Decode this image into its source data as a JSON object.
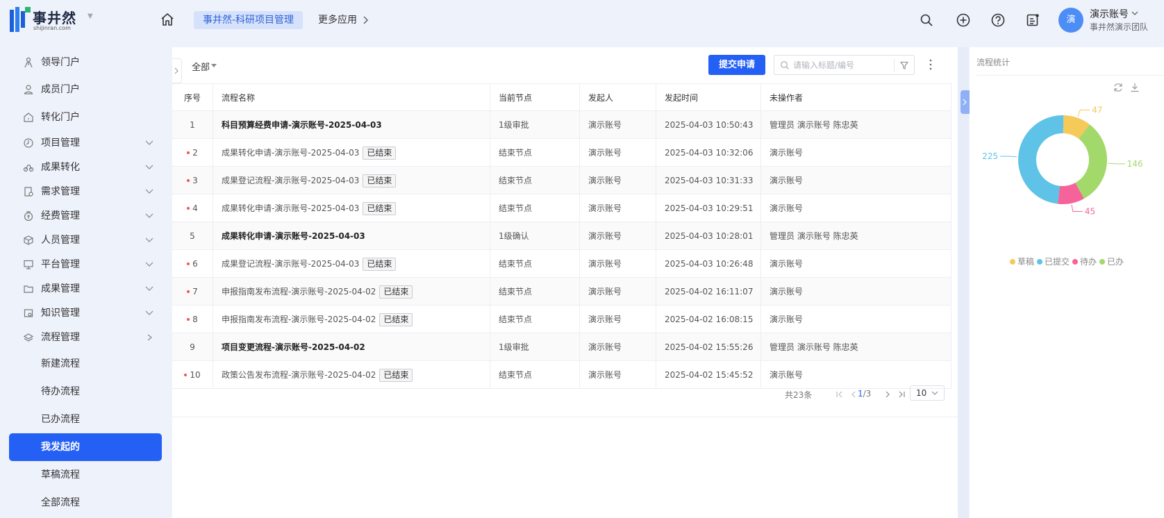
{
  "brand": {
    "name": "事井然",
    "sub": "shijinran.com"
  },
  "header": {
    "active_app": "事井然-科研项目管理",
    "more_apps": "更多应用",
    "avatar_text": "演",
    "user_name": "演示账号",
    "team": "事井然演示团队"
  },
  "sidebar": {
    "items": [
      {
        "label": "领导门户",
        "icon": "leader-icon"
      },
      {
        "label": "成员门户",
        "icon": "user-icon"
      },
      {
        "label": "转化门户",
        "icon": "home-icon"
      },
      {
        "label": "项目管理",
        "icon": "clock-icon"
      },
      {
        "label": "成果转化",
        "icon": "bike-icon"
      },
      {
        "label": "需求管理",
        "icon": "doc-icon"
      },
      {
        "label": "经费管理",
        "icon": "money-icon"
      },
      {
        "label": "人员管理",
        "icon": "cube-icon"
      },
      {
        "label": "平台管理",
        "icon": "monitor-icon"
      },
      {
        "label": "成果管理",
        "icon": "folder-icon"
      },
      {
        "label": "知识管理",
        "icon": "book-icon"
      },
      {
        "label": "流程管理",
        "icon": "layers-icon"
      }
    ],
    "sub_items": [
      "新建流程",
      "待办流程",
      "已办流程",
      "我发起的",
      "草稿流程",
      "全部流程"
    ],
    "active_sub": "我发起的"
  },
  "toolbar": {
    "filter_label": "全部",
    "submit_label": "提交申请",
    "search_placeholder": "请输入标题/编号"
  },
  "table": {
    "headers": [
      "序号",
      "流程名称",
      "当前节点",
      "发起人",
      "发起时间",
      "未操作者"
    ],
    "rows": [
      {
        "no": "1",
        "name": "科目预算经费申请-演示账号-2025-04-03",
        "node": "1级审批",
        "initiator": "演示账号",
        "time": "2025-04-03 10:50:43",
        "pending": "管理员 演示账号 陈忠英",
        "ended": false
      },
      {
        "no": "2",
        "name": "成果转化申请-演示账号-2025-04-03",
        "node": "结束节点",
        "initiator": "演示账号",
        "time": "2025-04-03 10:32:06",
        "pending": "演示账号",
        "ended": true
      },
      {
        "no": "3",
        "name": "成果登记流程-演示账号-2025-04-03",
        "node": "结束节点",
        "initiator": "演示账号",
        "time": "2025-04-03 10:31:33",
        "pending": "演示账号",
        "ended": true
      },
      {
        "no": "4",
        "name": "成果转化申请-演示账号-2025-04-03",
        "node": "结束节点",
        "initiator": "演示账号",
        "time": "2025-04-03 10:29:51",
        "pending": "演示账号",
        "ended": true
      },
      {
        "no": "5",
        "name": "成果转化申请-演示账号-2025-04-03",
        "node": "1级确认",
        "initiator": "演示账号",
        "time": "2025-04-03 10:28:01",
        "pending": "管理员 演示账号 陈忠英",
        "ended": false
      },
      {
        "no": "6",
        "name": "成果登记流程-演示账号-2025-04-03",
        "node": "结束节点",
        "initiator": "演示账号",
        "time": "2025-04-03 10:26:48",
        "pending": "演示账号",
        "ended": true
      },
      {
        "no": "7",
        "name": "申报指南发布流程-演示账号-2025-04-02",
        "node": "结束节点",
        "initiator": "演示账号",
        "time": "2025-04-02 16:11:07",
        "pending": "演示账号",
        "ended": true
      },
      {
        "no": "8",
        "name": "申报指南发布流程-演示账号-2025-04-02",
        "node": "结束节点",
        "initiator": "演示账号",
        "time": "2025-04-02 16:08:15",
        "pending": "演示账号",
        "ended": true
      },
      {
        "no": "9",
        "name": "项目变更流程-演示账号-2025-04-02",
        "node": "1级审批",
        "initiator": "演示账号",
        "time": "2025-04-02 15:55:26",
        "pending": "管理员 演示账号 陈忠英",
        "ended": false
      },
      {
        "no": "10",
        "name": "政策公告发布流程-演示账号-2025-04-02",
        "node": "结束节点",
        "initiator": "演示账号",
        "time": "2025-04-02 15:45:52",
        "pending": "演示账号",
        "ended": true
      }
    ],
    "ended_tag": "已结束"
  },
  "pagination": {
    "total": "共23条",
    "current": "1",
    "pages": "/3",
    "page_size": "10"
  },
  "stats_panel": {
    "title": "流程统计"
  },
  "chart_data": {
    "type": "pie",
    "donut": true,
    "title": "流程统计",
    "categories": [
      "草稿",
      "已提交",
      "待办",
      "已办"
    ],
    "values": [
      47,
      225,
      45,
      146
    ],
    "colors": [
      "#f5c95a",
      "#5ec3e6",
      "#f5639a",
      "#a3d86a"
    ],
    "legend": "bottom"
  },
  "colors": {
    "accent": "#2560f5",
    "active_nav_bg": "#d6e2fb",
    "ended_dot": "#f05454"
  }
}
